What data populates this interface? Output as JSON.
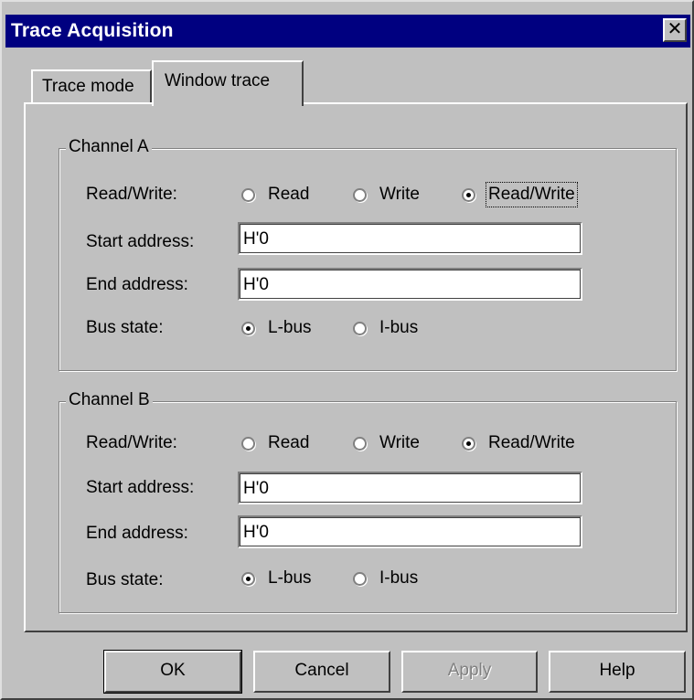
{
  "window": {
    "title": "Trace Acquisition",
    "close_glyph": "✕"
  },
  "tabs": [
    {
      "label": "Trace mode",
      "active": false
    },
    {
      "label": "Window trace",
      "active": true
    }
  ],
  "channel_a": {
    "legend": "Channel A",
    "rw_label": "Read/Write:",
    "rw_options": [
      "Read",
      "Write",
      "Read/Write"
    ],
    "rw_selected": "Read/Write",
    "start_label": "Start address:",
    "start_value": "H'0",
    "end_label": "End address:",
    "end_value": "H'0",
    "bus_label": "Bus state:",
    "bus_options": [
      "L-bus",
      "I-bus"
    ],
    "bus_selected": "L-bus"
  },
  "channel_b": {
    "legend": "Channel B",
    "rw_label": "Read/Write:",
    "rw_options": [
      "Read",
      "Write",
      "Read/Write"
    ],
    "rw_selected": "Read/Write",
    "start_label": "Start address:",
    "start_value": "H'0",
    "end_label": "End address:",
    "end_value": "H'0",
    "bus_label": "Bus state:",
    "bus_options": [
      "L-bus",
      "I-bus"
    ],
    "bus_selected": "L-bus"
  },
  "buttons": {
    "ok": "OK",
    "cancel": "Cancel",
    "apply": "Apply",
    "help": "Help",
    "apply_enabled": false
  }
}
